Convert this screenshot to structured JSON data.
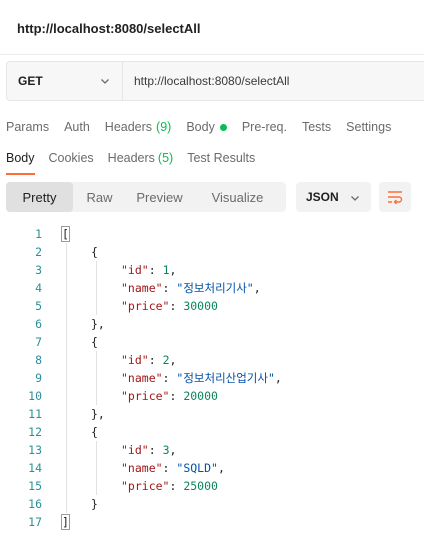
{
  "window": {
    "title": "http://localhost:8080/selectAll"
  },
  "request": {
    "method": "GET",
    "url": "http://localhost:8080/selectAll"
  },
  "request_tabs": [
    {
      "label": "Params"
    },
    {
      "label": "Auth"
    },
    {
      "label": "Headers",
      "count": "(9)"
    },
    {
      "label": "Body"
    },
    {
      "label": "Pre-req."
    },
    {
      "label": "Tests"
    },
    {
      "label": "Settings"
    }
  ],
  "response_tabs": [
    {
      "label": "Body"
    },
    {
      "label": "Cookies"
    },
    {
      "label": "Headers",
      "count": "(5)"
    },
    {
      "label": "Test Results"
    }
  ],
  "view_modes": [
    "Pretty",
    "Raw",
    "Preview",
    "Visualize"
  ],
  "format": "JSON",
  "colors": {
    "accent": "#ff6c37",
    "count_green": "#0cbb52",
    "line_number": "#2a8f9a"
  },
  "icons": {
    "method_dropdown": "chevron-down-icon",
    "format_dropdown": "chevron-down-icon",
    "wrap": "wrap-lines-icon",
    "body_indicator": "dot-icon"
  },
  "response_body": {
    "line_numbers": [
      "1",
      "2",
      "3",
      "4",
      "5",
      "6",
      "7",
      "8",
      "9",
      "10",
      "11",
      "12",
      "13",
      "14",
      "15",
      "16",
      "17"
    ],
    "items": [
      {
        "id": "1",
        "name": "\"정보처리기사\"",
        "price": "30000"
      },
      {
        "id": "2",
        "name": "\"정보처리산업기사\"",
        "price": "20000"
      },
      {
        "id": "3",
        "name": "\"SQLD\"",
        "price": "25000"
      }
    ],
    "key_id": "\"id\"",
    "key_name": "\"name\"",
    "key_price": "\"price\"",
    "open_array": "[",
    "close_array": "]",
    "open_obj": "{",
    "close_obj": "}",
    "close_obj_comma": "},"
  }
}
